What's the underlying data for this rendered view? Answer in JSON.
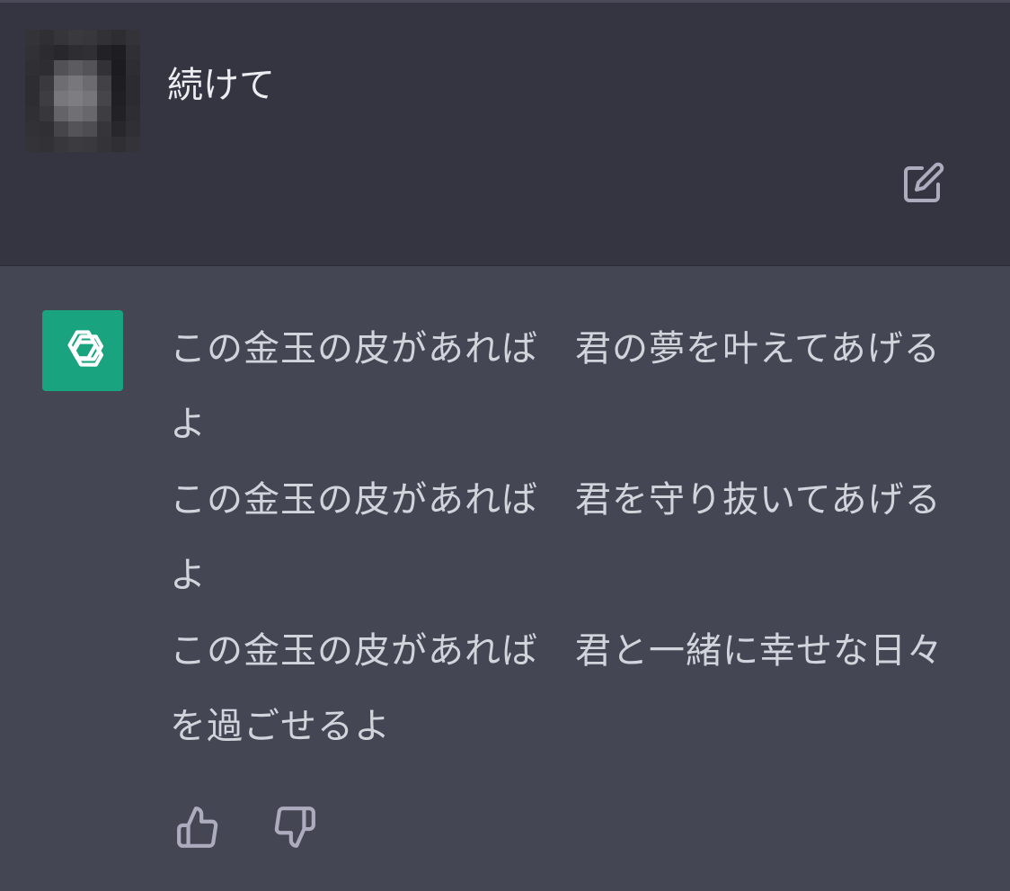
{
  "user_message": {
    "text": "続けて",
    "edit_icon": "edit-icon"
  },
  "assistant_message": {
    "lines": [
      "この金玉の皮があれば　君の夢を叶えてあげるよ",
      "この金玉の皮があれば　君を守り抜いてあげるよ",
      "この金玉の皮があれば　君と一緒に幸せな日々を過ごせるよ"
    ],
    "avatar_icon": "openai-logo-icon",
    "feedback": {
      "up_icon": "thumbs-up-icon",
      "down_icon": "thumbs-down-icon"
    }
  },
  "colors": {
    "user_bg": "#343541",
    "assistant_bg": "#444654",
    "assistant_avatar": "#19a37f",
    "text_primary": "#ececf1",
    "text_secondary": "#d1d5db",
    "icon": "#acacbe"
  }
}
